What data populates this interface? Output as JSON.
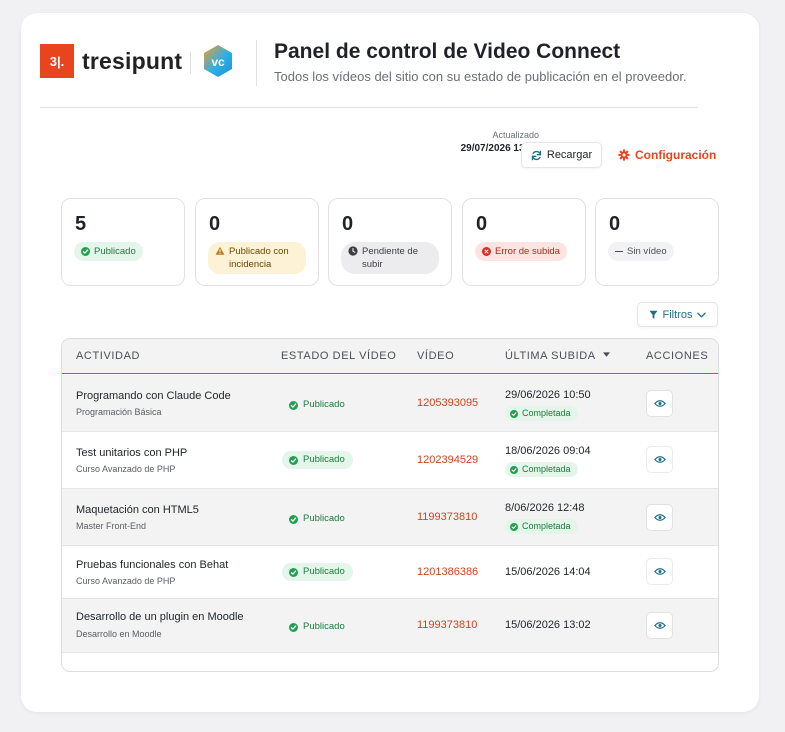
{
  "header": {
    "brand_mark": "3|.",
    "brand_name": "tresipunt",
    "vc_mark": "vc",
    "title": "Panel de control de Video Connect",
    "subtitle": "Todos los vídeos del sitio con su estado de publicación en el proveedor."
  },
  "toolbar": {
    "updated_label": "Actualizado",
    "updated_value": "29/07/2026 13:20",
    "reload_label": "Recargar",
    "config_label": "Configuración",
    "filters_label": "Filtros"
  },
  "stats": [
    {
      "count": "5",
      "label": "Publicado",
      "status": "published"
    },
    {
      "count": "0",
      "label": "Publicado con incidencia",
      "status": "warning"
    },
    {
      "count": "0",
      "label": "Pendiente de subir",
      "status": "pending"
    },
    {
      "count": "0",
      "label": "Error de subida",
      "status": "error"
    },
    {
      "count": "0",
      "label": "Sin vídeo",
      "status": "none"
    }
  ],
  "table": {
    "columns": [
      "ACTIVIDAD",
      "ESTADO DEL VÍDEO",
      "VÍDEO",
      "ÚLTIMA SUBIDA",
      "ACCIONES"
    ],
    "rows": [
      {
        "title": "Programando con Claude Code",
        "course": "Programación Básica",
        "state": "Publicado",
        "video": "1205393095",
        "date": "29/06/2026 10:50",
        "upload_state": "Completada"
      },
      {
        "title": "Test unitarios con PHP",
        "course": "Curso Avanzado de PHP",
        "state": "Publicado",
        "video": "1202394529",
        "date": "18/06/2026 09:04",
        "upload_state": "Completada"
      },
      {
        "title": "Maquetación con HTML5",
        "course": "Master Front-End",
        "state": "Publicado",
        "video": "1199373810",
        "date": "8/06/2026 12:48",
        "upload_state": "Completada"
      },
      {
        "title": "Pruebas funcionales con Behat",
        "course": "Curso Avanzado de PHP",
        "state": "Publicado",
        "video": "1201386386",
        "date": "15/06/2026 14:04",
        "upload_state": ""
      },
      {
        "title": "Desarrollo de un plugin en Moodle",
        "course": "Desarrollo en Moodle",
        "state": "Publicado",
        "video": "1199373810",
        "date": "15/06/2026 13:02",
        "upload_state": ""
      }
    ]
  },
  "colors": {
    "accent": "#e8451f",
    "link": "#d63f1a",
    "success": "#1b7b3c",
    "info": "#1f6f8b"
  },
  "icons": {
    "reload": "refresh-icon",
    "config": "gear-icon",
    "filter": "funnel-icon",
    "sort": "caret-down-icon",
    "action": "eye-icon"
  }
}
